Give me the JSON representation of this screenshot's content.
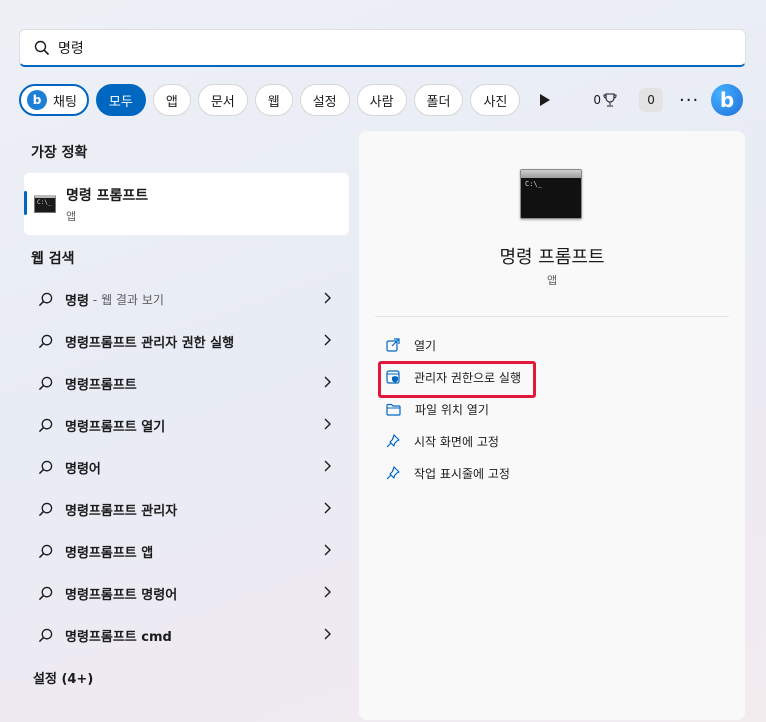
{
  "search": {
    "value": "명령"
  },
  "filters": {
    "chat_label": "채팅",
    "bing_letter": "b",
    "tabs": [
      "모두",
      "앱",
      "문서",
      "웹",
      "설정",
      "사람",
      "폴더",
      "사진"
    ],
    "reward_points": "0",
    "count": "0",
    "more": "···"
  },
  "left": {
    "best_match_title": "가장 정확",
    "best_match": {
      "name": "명령 프롬프트",
      "type": "앱",
      "icon_text": "C:\\_"
    },
    "web_title": "웹 검색",
    "web_items": [
      {
        "label": "명령",
        "suffix": "- 웹 결과 보기"
      },
      {
        "label": "명령프롬프트 관리자 권한 실행",
        "suffix": ""
      },
      {
        "label": "명령프롬프트",
        "suffix": ""
      },
      {
        "label": "명령프롬프트 열기",
        "suffix": ""
      },
      {
        "label": "명령어",
        "suffix": ""
      },
      {
        "label": "명령프롬프트 관리자",
        "suffix": ""
      },
      {
        "label": "명령프롬프트 앱",
        "suffix": ""
      },
      {
        "label": "명령프롬프트 명령어",
        "suffix": ""
      },
      {
        "label": "명령프롬프트 cmd",
        "suffix": ""
      }
    ],
    "settings_title": "설정 (4+)"
  },
  "panel": {
    "title": "명령 프롬프트",
    "subtitle": "앱",
    "icon_text": "C:\\_",
    "actions": [
      "열기",
      "관리자 권한으로 실행",
      "파일 위치 열기",
      "시작 화면에 고정",
      "작업 표시줄에 고정"
    ]
  },
  "colors": {
    "accent": "#0067c0",
    "highlight": "#e3173a"
  }
}
